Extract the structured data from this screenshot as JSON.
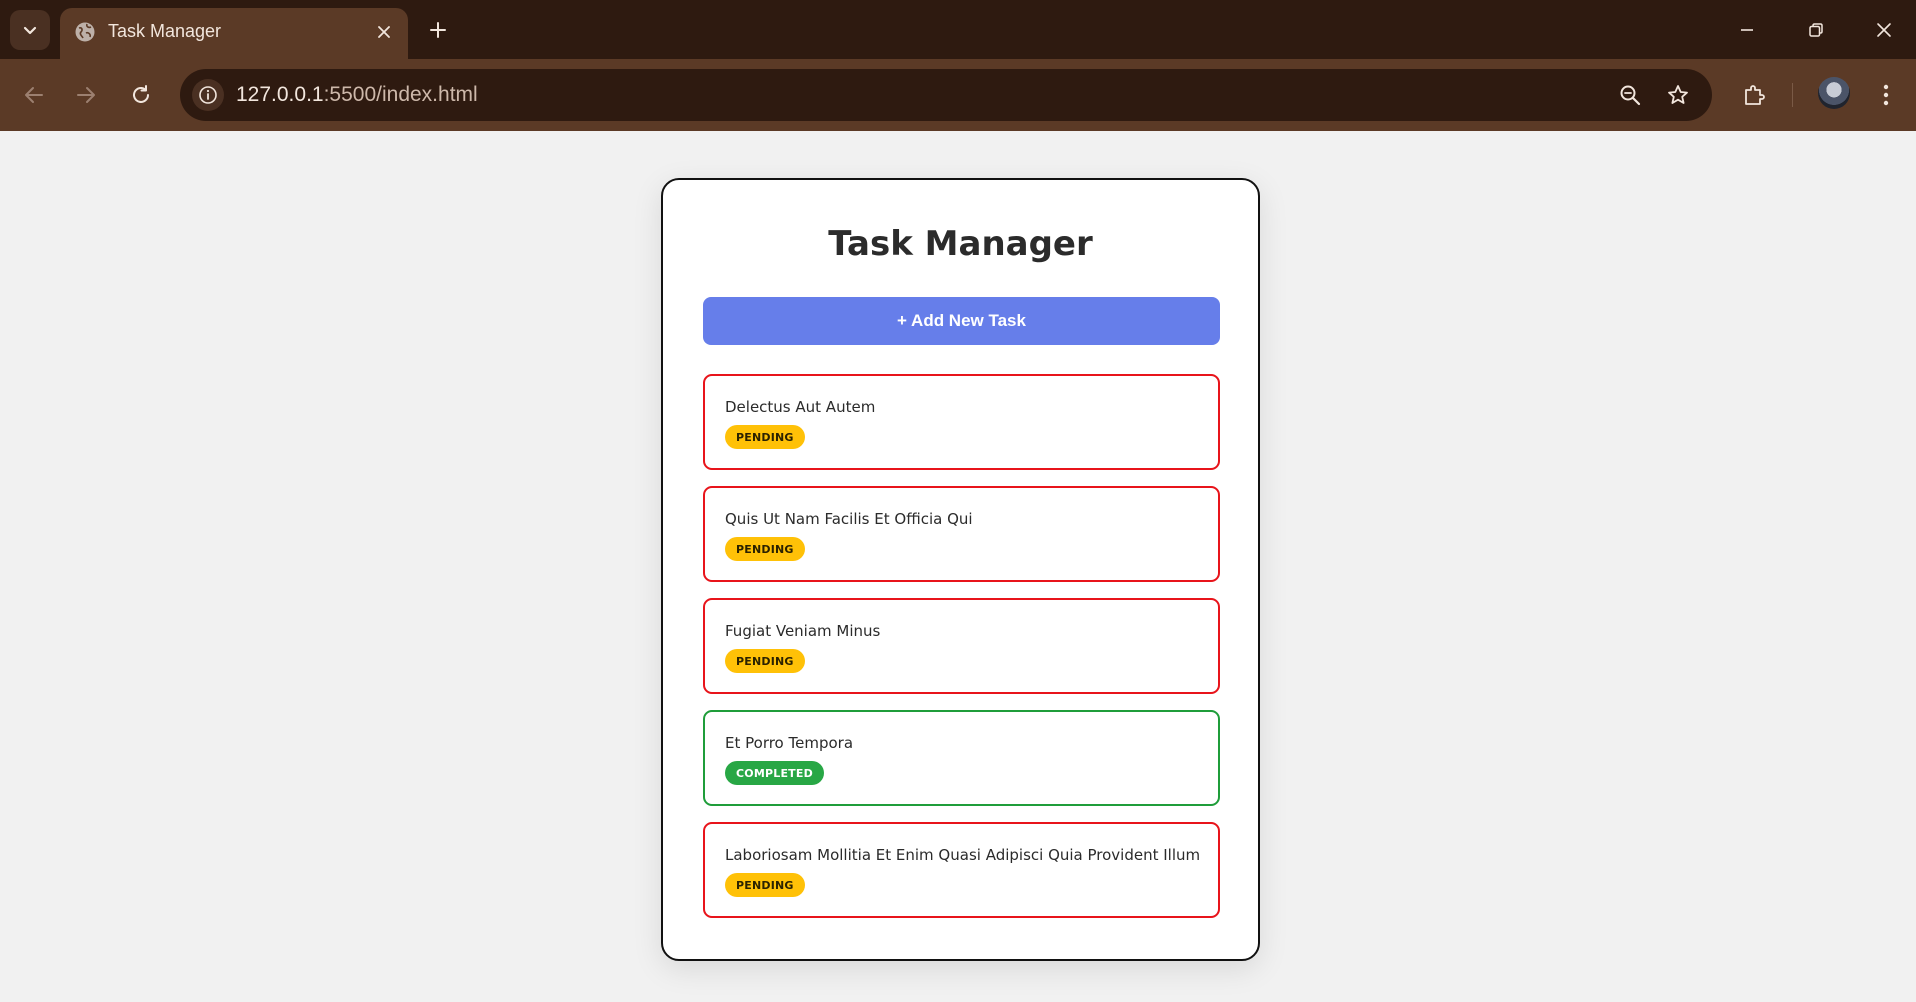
{
  "browser": {
    "tab_title": "Task Manager",
    "url_host": "127.0.0.1",
    "url_path": ":5500/index.html"
  },
  "app": {
    "title": "Task Manager",
    "add_button_label": "+ Add New Task",
    "tasks": [
      {
        "title": "Delectus Aut Autem",
        "status": "PENDING"
      },
      {
        "title": "Quis Ut Nam Facilis Et Officia Qui",
        "status": "PENDING"
      },
      {
        "title": "Fugiat Veniam Minus",
        "status": "PENDING"
      },
      {
        "title": "Et Porro Tempora",
        "status": "COMPLETED"
      },
      {
        "title": "Laboriosam Mollitia Et Enim Quasi Adipisci Quia Provident Illum",
        "status": "PENDING"
      }
    ]
  },
  "colors": {
    "accent": "#667eea",
    "pending_border": "#e8141b",
    "completed_border": "#1f9d3a",
    "pending_badge": "#ffc107",
    "completed_badge": "#28a745"
  }
}
